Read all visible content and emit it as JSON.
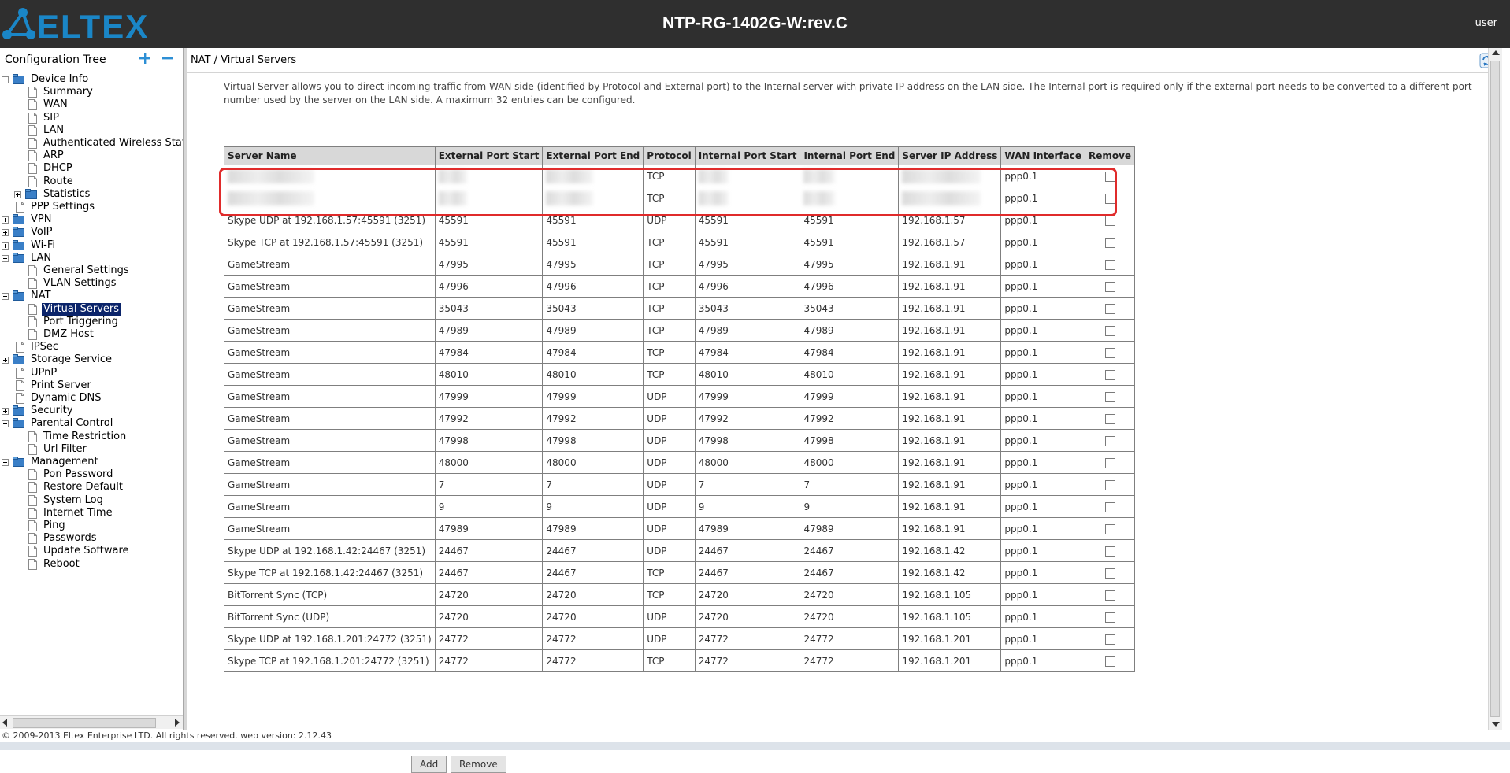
{
  "header": {
    "brand": "ELTEX",
    "device_title": "NTP-RG-1402G-W:rev.C",
    "user_label": "user"
  },
  "tree": {
    "title": "Configuration Tree",
    "items": [
      {
        "label": "Device Info",
        "level": 0,
        "type": "folder",
        "toggle": "minus"
      },
      {
        "label": "Summary",
        "level": 1,
        "type": "page"
      },
      {
        "label": "WAN",
        "level": 1,
        "type": "page"
      },
      {
        "label": "SIP",
        "level": 1,
        "type": "page"
      },
      {
        "label": "LAN",
        "level": 1,
        "type": "page"
      },
      {
        "label": "Authenticated Wireless Statio",
        "level": 1,
        "type": "page"
      },
      {
        "label": "ARP",
        "level": 1,
        "type": "page"
      },
      {
        "label": "DHCP",
        "level": 1,
        "type": "page"
      },
      {
        "label": "Route",
        "level": 1,
        "type": "page"
      },
      {
        "label": "Statistics",
        "level": 1,
        "type": "folder",
        "toggle": "plus"
      },
      {
        "label": "PPP Settings",
        "level": 0,
        "type": "page"
      },
      {
        "label": "VPN",
        "level": 0,
        "type": "folder",
        "toggle": "plus"
      },
      {
        "label": "VoIP",
        "level": 0,
        "type": "folder",
        "toggle": "plus"
      },
      {
        "label": "Wi-Fi",
        "level": 0,
        "type": "folder",
        "toggle": "plus"
      },
      {
        "label": "LAN",
        "level": 0,
        "type": "folder",
        "toggle": "minus"
      },
      {
        "label": "General Settings",
        "level": 1,
        "type": "page"
      },
      {
        "label": "VLAN Settings",
        "level": 1,
        "type": "page"
      },
      {
        "label": "NAT",
        "level": 0,
        "type": "folder",
        "toggle": "minus"
      },
      {
        "label": "Virtual Servers",
        "level": 1,
        "type": "page",
        "selected": true
      },
      {
        "label": "Port Triggering",
        "level": 1,
        "type": "page"
      },
      {
        "label": "DMZ Host",
        "level": 1,
        "type": "page"
      },
      {
        "label": "IPSec",
        "level": 0,
        "type": "page"
      },
      {
        "label": "Storage Service",
        "level": 0,
        "type": "folder",
        "toggle": "plus"
      },
      {
        "label": "UPnP",
        "level": 0,
        "type": "page"
      },
      {
        "label": "Print Server",
        "level": 0,
        "type": "page"
      },
      {
        "label": "Dynamic DNS",
        "level": 0,
        "type": "page"
      },
      {
        "label": "Security",
        "level": 0,
        "type": "folder",
        "toggle": "plus"
      },
      {
        "label": "Parental Control",
        "level": 0,
        "type": "folder",
        "toggle": "minus"
      },
      {
        "label": "Time Restriction",
        "level": 1,
        "type": "page"
      },
      {
        "label": "Url Filter",
        "level": 1,
        "type": "page"
      },
      {
        "label": "Management",
        "level": 0,
        "type": "folder",
        "toggle": "minus"
      },
      {
        "label": "Pon Password",
        "level": 1,
        "type": "page"
      },
      {
        "label": "Restore Default",
        "level": 1,
        "type": "page"
      },
      {
        "label": "System Log",
        "level": 1,
        "type": "page"
      },
      {
        "label": "Internet Time",
        "level": 1,
        "type": "page"
      },
      {
        "label": "Ping",
        "level": 1,
        "type": "page"
      },
      {
        "label": "Passwords",
        "level": 1,
        "type": "page"
      },
      {
        "label": "Update Software",
        "level": 1,
        "type": "page"
      },
      {
        "label": "Reboot",
        "level": 1,
        "type": "page"
      }
    ]
  },
  "main": {
    "breadcrumb": "NAT / Virtual Servers",
    "description": "Virtual Server allows you to direct incoming traffic from WAN side (identified by Protocol and External port) to the Internal server with private IP address on the LAN side. The Internal port is required only if the external port needs to be converted to a different port number used by the server on the LAN side. A maximum 32 entries can be configured.",
    "columns": [
      "Server Name",
      "External Port Start",
      "External Port End",
      "Protocol",
      "Internal Port Start",
      "Internal Port End",
      "Server IP Address",
      "WAN Interface",
      "Remove"
    ],
    "rows": [
      {
        "redacted": true,
        "cells": [
          "",
          "",
          "",
          "TCP",
          "",
          "",
          "",
          "ppp0.1"
        ]
      },
      {
        "redacted": true,
        "cells": [
          "",
          "",
          "",
          "TCP",
          "",
          "",
          "",
          "ppp0.1"
        ]
      },
      {
        "cells": [
          "Skype UDP at 192.168.1.57:45591 (3251)",
          "45591",
          "45591",
          "UDP",
          "45591",
          "45591",
          "192.168.1.57",
          "ppp0.1"
        ]
      },
      {
        "cells": [
          "Skype TCP at 192.168.1.57:45591 (3251)",
          "45591",
          "45591",
          "TCP",
          "45591",
          "45591",
          "192.168.1.57",
          "ppp0.1"
        ]
      },
      {
        "cells": [
          "GameStream",
          "47995",
          "47995",
          "TCP",
          "47995",
          "47995",
          "192.168.1.91",
          "ppp0.1"
        ]
      },
      {
        "cells": [
          "GameStream",
          "47996",
          "47996",
          "TCP",
          "47996",
          "47996",
          "192.168.1.91",
          "ppp0.1"
        ]
      },
      {
        "cells": [
          "GameStream",
          "35043",
          "35043",
          "TCP",
          "35043",
          "35043",
          "192.168.1.91",
          "ppp0.1"
        ]
      },
      {
        "cells": [
          "GameStream",
          "47989",
          "47989",
          "TCP",
          "47989",
          "47989",
          "192.168.1.91",
          "ppp0.1"
        ]
      },
      {
        "cells": [
          "GameStream",
          "47984",
          "47984",
          "TCP",
          "47984",
          "47984",
          "192.168.1.91",
          "ppp0.1"
        ]
      },
      {
        "cells": [
          "GameStream",
          "48010",
          "48010",
          "TCP",
          "48010",
          "48010",
          "192.168.1.91",
          "ppp0.1"
        ]
      },
      {
        "cells": [
          "GameStream",
          "47999",
          "47999",
          "UDP",
          "47999",
          "47999",
          "192.168.1.91",
          "ppp0.1"
        ]
      },
      {
        "cells": [
          "GameStream",
          "47992",
          "47992",
          "UDP",
          "47992",
          "47992",
          "192.168.1.91",
          "ppp0.1"
        ]
      },
      {
        "cells": [
          "GameStream",
          "47998",
          "47998",
          "UDP",
          "47998",
          "47998",
          "192.168.1.91",
          "ppp0.1"
        ]
      },
      {
        "cells": [
          "GameStream",
          "48000",
          "48000",
          "UDP",
          "48000",
          "48000",
          "192.168.1.91",
          "ppp0.1"
        ]
      },
      {
        "cells": [
          "GameStream",
          "7",
          "7",
          "UDP",
          "7",
          "7",
          "192.168.1.91",
          "ppp0.1"
        ]
      },
      {
        "cells": [
          "GameStream",
          "9",
          "9",
          "UDP",
          "9",
          "9",
          "192.168.1.91",
          "ppp0.1"
        ]
      },
      {
        "cells": [
          "GameStream",
          "47989",
          "47989",
          "UDP",
          "47989",
          "47989",
          "192.168.1.91",
          "ppp0.1"
        ]
      },
      {
        "cells": [
          "Skype UDP at 192.168.1.42:24467 (3251)",
          "24467",
          "24467",
          "UDP",
          "24467",
          "24467",
          "192.168.1.42",
          "ppp0.1"
        ]
      },
      {
        "cells": [
          "Skype TCP at 192.168.1.42:24467 (3251)",
          "24467",
          "24467",
          "TCP",
          "24467",
          "24467",
          "192.168.1.42",
          "ppp0.1"
        ]
      },
      {
        "cells": [
          "BitTorrent Sync (TCP)",
          "24720",
          "24720",
          "TCP",
          "24720",
          "24720",
          "192.168.1.105",
          "ppp0.1"
        ]
      },
      {
        "cells": [
          "BitTorrent Sync (UDP)",
          "24720",
          "24720",
          "UDP",
          "24720",
          "24720",
          "192.168.1.105",
          "ppp0.1"
        ]
      },
      {
        "cells": [
          "Skype UDP at 192.168.1.201:24772 (3251)",
          "24772",
          "24772",
          "UDP",
          "24772",
          "24772",
          "192.168.1.201",
          "ppp0.1"
        ]
      },
      {
        "cells": [
          "Skype TCP at 192.168.1.201:24772 (3251)",
          "24772",
          "24772",
          "TCP",
          "24772",
          "24772",
          "192.168.1.201",
          "ppp0.1"
        ]
      }
    ],
    "buttons": {
      "add": "Add",
      "remove": "Remove"
    }
  },
  "footer": {
    "text": "© 2009-2013 Eltex Enterprise LTD. All rights reserved. web version: 2.12.43"
  },
  "icons": {
    "logo": "eltex-logo-icon",
    "expand_all": "expand-all-icon",
    "collapse_all": "collapse-all-icon",
    "folder": "folder-icon",
    "page": "page-icon",
    "refresh": "refresh-icon"
  },
  "colors": {
    "header_bg": "#2f2f2f",
    "accent_blue": "#1a86c7",
    "selected_bg": "#0b246a",
    "highlight_red": "#e02b2b",
    "table_header_bg": "#d8d8d8"
  }
}
